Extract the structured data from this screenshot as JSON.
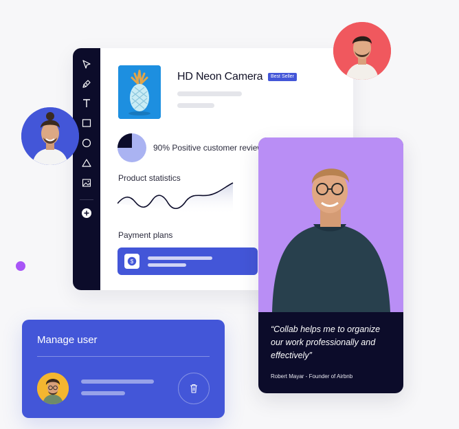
{
  "product": {
    "title": "HD Neon Camera",
    "badge": "Best Seller"
  },
  "review": {
    "positive_percent": 90,
    "text": "90% Positive customer reviews"
  },
  "statistics": {
    "label": "Product statistics"
  },
  "payment": {
    "label": "Payment plans"
  },
  "testimonial": {
    "quote": "“Collab helps me to organize our work professionally and effectively”",
    "author": "Robert Mayar",
    "role": "Founder of Airbnb",
    "author_line": "Robert Mayar  -  Founder of Airbnb"
  },
  "manage_user": {
    "title": "Manage user"
  },
  "toolbar": {
    "tools": [
      "cursor-icon",
      "pen-icon",
      "text-icon",
      "rectangle-icon",
      "circle-icon",
      "triangle-icon",
      "image-icon",
      "add-icon"
    ]
  },
  "colors": {
    "accent": "#4356d8",
    "dark": "#0c0c2a",
    "purple": "#b98ef5",
    "dot": "#a855f7",
    "avatar_red": "#f0585e",
    "avatar_blue": "#4356d8",
    "avatar_yellow": "#f4b630"
  }
}
